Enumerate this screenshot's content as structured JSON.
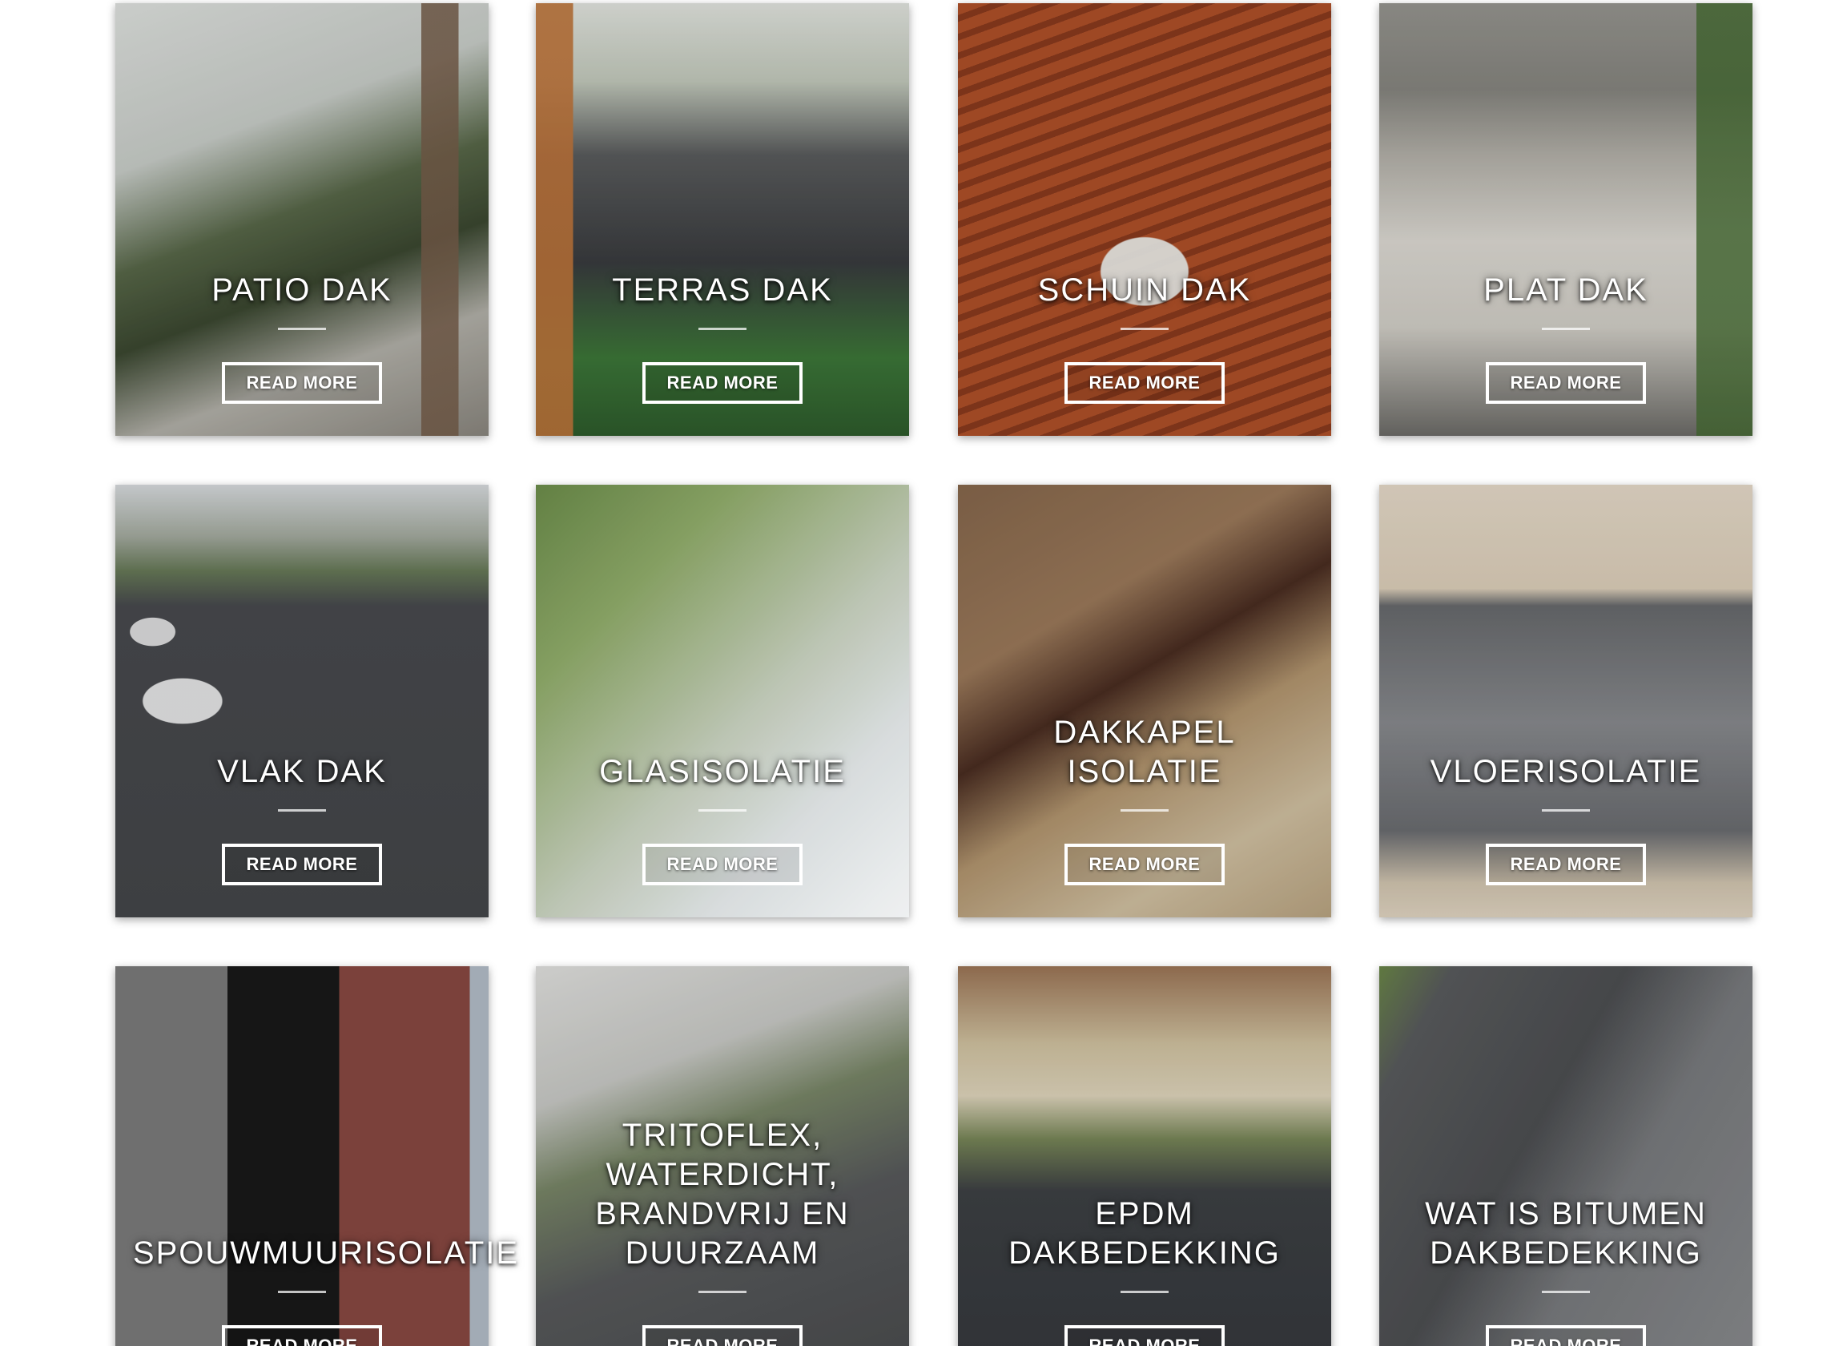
{
  "cards": [
    {
      "title": "PATIO DAK",
      "button": "READ MORE"
    },
    {
      "title": "TERRAS DAK",
      "button": "READ MORE"
    },
    {
      "title": "SCHUIN DAK",
      "button": "READ MORE"
    },
    {
      "title": "PLAT DAK",
      "button": "READ MORE"
    },
    {
      "title": "VLAK DAK",
      "button": "READ MORE"
    },
    {
      "title": "GLASISOLATIE",
      "button": "READ MORE"
    },
    {
      "title": "DAKKAPEL\nISOLATIE",
      "button": "READ MORE"
    },
    {
      "title": "VLOERISOLATIE",
      "button": "READ MORE"
    },
    {
      "title": "SPOUWMUURISOLATIE",
      "button": "READ MORE"
    },
    {
      "title": "TRITOFLEX,\nWATERDICHT,\nBRANDVRIJ EN\nDUURZAAM",
      "button": "READ MORE"
    },
    {
      "title": "EPDM\nDAKBEDEKKING",
      "button": "READ MORE"
    },
    {
      "title": "WAT IS BITUMEN\nDAKBEDEKKING",
      "button": "READ MORE"
    }
  ],
  "colors": {
    "button_border": "#ffffff",
    "title_text": "#ffffff",
    "page_background": "#ffffff"
  }
}
